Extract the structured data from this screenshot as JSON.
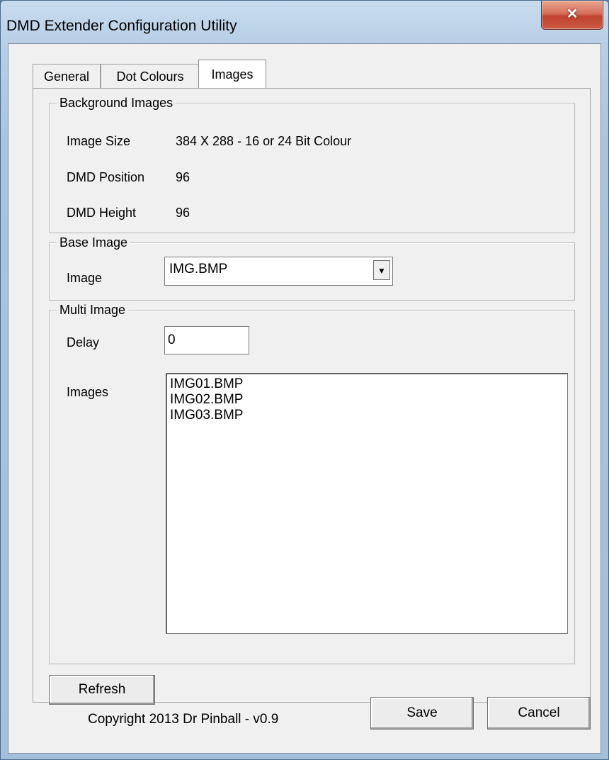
{
  "window": {
    "title": "DMD Extender Configuration Utility",
    "close_glyph": "✕"
  },
  "tabs": [
    {
      "label": "General"
    },
    {
      "label": "Dot Colours"
    },
    {
      "label": "Images",
      "active": true
    }
  ],
  "background_images": {
    "legend": "Background Images",
    "rows": [
      {
        "label": "Image Size",
        "value": "384 X 288 - 16 or 24 Bit Colour"
      },
      {
        "label": "DMD Position",
        "value": "96"
      },
      {
        "label": "DMD Height",
        "value": "96"
      }
    ]
  },
  "base_image": {
    "legend": "Base Image",
    "label": "Image",
    "selected": "IMG.BMP"
  },
  "multi_image": {
    "legend": "Multi Image",
    "delay_label": "Delay",
    "delay_value": "0",
    "images_label": "Images",
    "images": [
      "IMG01.BMP",
      "IMG02.BMP",
      "IMG03.BMP"
    ]
  },
  "buttons": {
    "refresh": "Refresh",
    "save": "Save",
    "cancel": "Cancel"
  },
  "footer": {
    "copyright": "Copyright 2013 Dr Pinball - v0.9"
  }
}
